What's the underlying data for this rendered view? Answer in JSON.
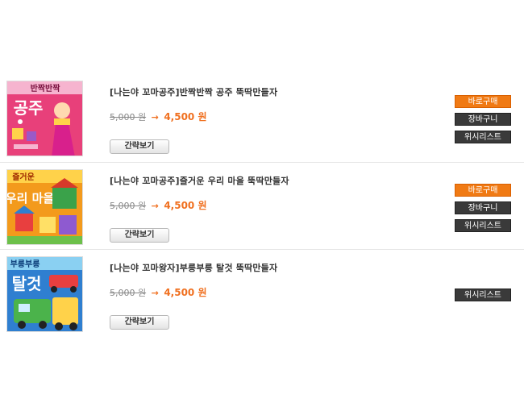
{
  "products": [
    {
      "title": "[나는야 꼬마공주]반짝반짝 공주 뚝딱만들자",
      "original_price": "5,000 원",
      "arrow": "→",
      "sale_price": "4,500 원",
      "quick_view_label": "간략보기",
      "buy_now_label": "바로구매",
      "cart_label": "장바구니",
      "wishlist_label": "위시리스트",
      "cover_text_top": "반짝반짝",
      "cover_text_main": "공주",
      "cover_colors": [
        "#e8407a",
        "#f6b4cf"
      ]
    },
    {
      "title": "[나는야 꼬마공주]즐거운 우리 마을 뚝딱만들자",
      "original_price": "5,000 원",
      "arrow": "→",
      "sale_price": "4,500 원",
      "quick_view_label": "간략보기",
      "buy_now_label": "바로구매",
      "cart_label": "장바구니",
      "wishlist_label": "위시리스트",
      "cover_text_top": "즐거운",
      "cover_text_main": "우리 마을",
      "cover_colors": [
        "#f39a1c",
        "#ffd24a"
      ]
    },
    {
      "title": "[나는야 꼬마왕자]부릉부릉 탈것 뚝딱만들자",
      "original_price": "5,000 원",
      "arrow": "→",
      "sale_price": "4,500 원",
      "quick_view_label": "간략보기",
      "wishlist_label": "위시리스트",
      "cover_text_top": "부릉부릉",
      "cover_text_main": "탈것",
      "cover_colors": [
        "#2f7fd0",
        "#8ad0f2"
      ]
    }
  ]
}
